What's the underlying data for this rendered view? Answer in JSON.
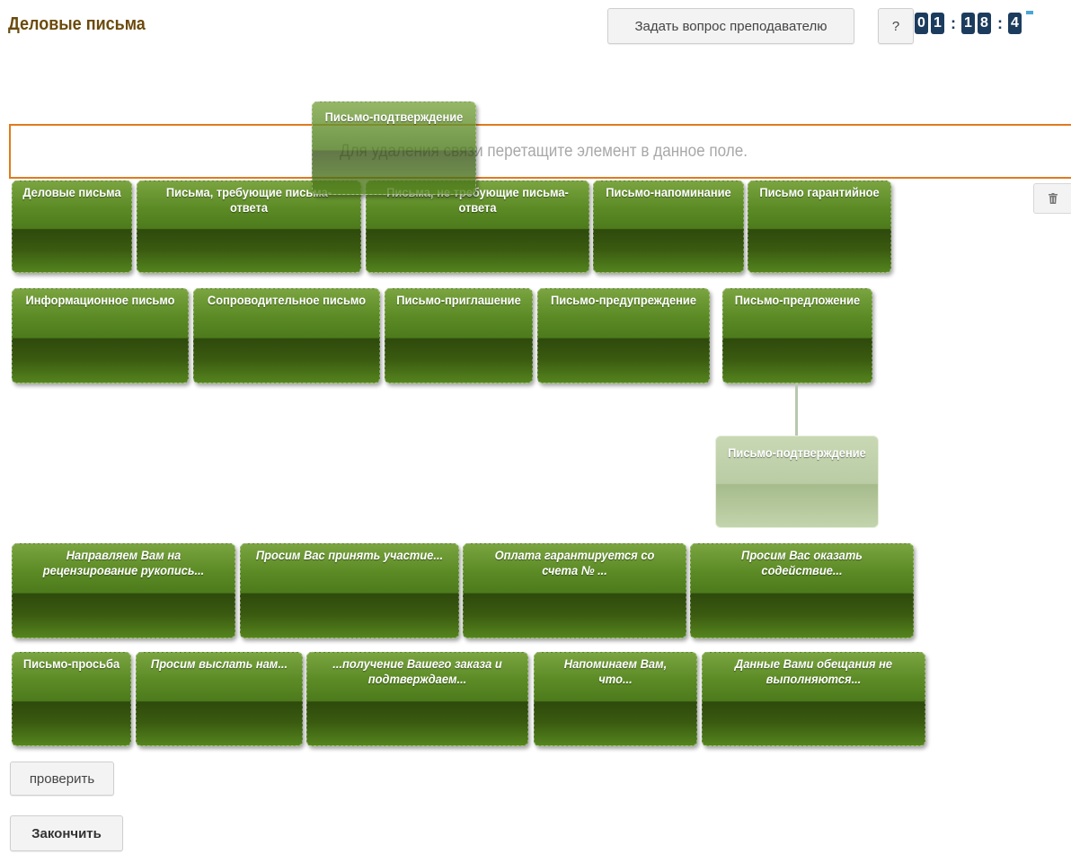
{
  "header": {
    "title": "Деловые письма",
    "ask_button": "Задать вопрос преподавателю",
    "help_button": "?"
  },
  "timer": {
    "digits": [
      "0",
      "1",
      "1",
      "8",
      "4"
    ],
    "separator": ":"
  },
  "dropzone": {
    "hint": "Для удаления связи перетащите элемент в данное поле.",
    "border_color": "#e07a1f"
  },
  "trash_icon": "trash-icon",
  "dragged_card": "Письмо-подтверждение",
  "placed_card": "Письмо-подтверждение",
  "categories_row1": [
    "Деловые письма",
    "Письма, требующие письма-ответа",
    "Письма, не требующие письма-ответа",
    "Письмо-напоминание",
    "Письмо гарантийное"
  ],
  "categories_row2": [
    "Информационное письмо",
    "Сопроводительное письмо",
    "Письмо-приглашение",
    "Письмо-предупреждение",
    "Письмо-предложение"
  ],
  "phrases_row1": [
    "Направляем Вам на рецензирование рукопись...",
    "Просим Вас принять участие...",
    "Оплата гарантируется со счета № ...",
    "Просим Вас оказать содействие..."
  ],
  "phrases_row2": [
    "Письмо-просьба",
    "Просим выслать нам...",
    "...получение Вашего заказа и подтверждаем...",
    "Напоминаем Вам, что...",
    "Данные Вами обещания не выполняются..."
  ],
  "buttons": {
    "check": "проверить",
    "finish": "Закончить"
  },
  "colors": {
    "card_green": "#4d7b1c",
    "title_brown": "#6b4a0c",
    "timer_blue": "#1c3c5e"
  }
}
